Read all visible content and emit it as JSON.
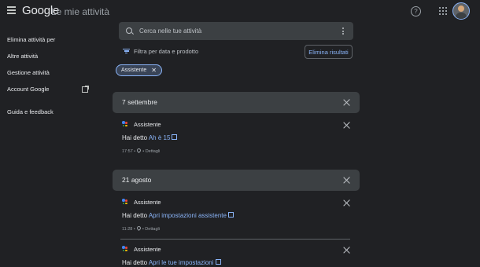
{
  "header": {
    "logo": "Google",
    "subtitle": "Le mie attività",
    "help_icon": "help-circle-icon",
    "apps_icon": "apps-grid-icon"
  },
  "sidebar": {
    "items": [
      {
        "label": "Elimina attività per"
      },
      {
        "label": "Altre attività"
      },
      {
        "label": "Gestione attività"
      },
      {
        "label": "Account Google",
        "icon": "open-in-new-icon"
      },
      {
        "label": "Guida e feedback"
      }
    ]
  },
  "search": {
    "placeholder": "Cerca nelle tue attività"
  },
  "filter": {
    "label": "Filtra per data e prodotto"
  },
  "actions": {
    "delete_results": "Elimina risultati"
  },
  "chip": {
    "label": "Assistente"
  },
  "groups": [
    {
      "date": "7 settembre",
      "entries": [
        {
          "app": "Assistente",
          "prefix": "Hai detto ",
          "query": "Ah è 15",
          "time": "17:57",
          "details": "Dettagli"
        }
      ]
    },
    {
      "date": "21 agosto",
      "entries": [
        {
          "app": "Assistente",
          "prefix": "Hai detto ",
          "query": "Apri impostazioni assistente",
          "time": "11:28",
          "details": "Dettagli"
        },
        {
          "app": "Assistente",
          "prefix": "Hai detto ",
          "query": "Apri le tue impostazioni"
        }
      ]
    }
  ],
  "colors": {
    "background": "#202124",
    "card": "#3c4043",
    "accent": "#8ab4f8"
  }
}
